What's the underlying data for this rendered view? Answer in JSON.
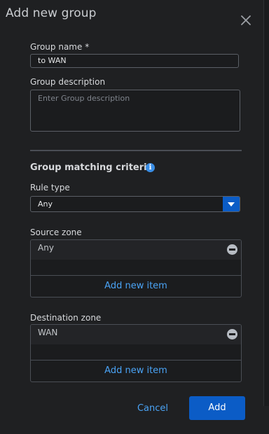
{
  "dialog": {
    "title": "Add new group",
    "close_icon": "close-icon"
  },
  "group_name": {
    "label": "Group name *",
    "value": "to WAN"
  },
  "group_description": {
    "label": "Group description",
    "placeholder": "Enter Group description"
  },
  "criteria": {
    "title": "Group matching criteria",
    "info_icon": "info-icon"
  },
  "rule_type": {
    "label": "Rule type",
    "selected": "Any"
  },
  "source_zone": {
    "label": "Source zone",
    "items": [
      "Any"
    ],
    "add_label": "Add new item"
  },
  "destination_zone": {
    "label": "Destination zone",
    "items": [
      "WAN"
    ],
    "add_label": "Add new item"
  },
  "actions": {
    "cancel_label": "Cancel",
    "add_label": "Add"
  },
  "colors": {
    "background": "#1f2022",
    "accent": "#0b5cc6",
    "link": "#4aa3f5"
  }
}
